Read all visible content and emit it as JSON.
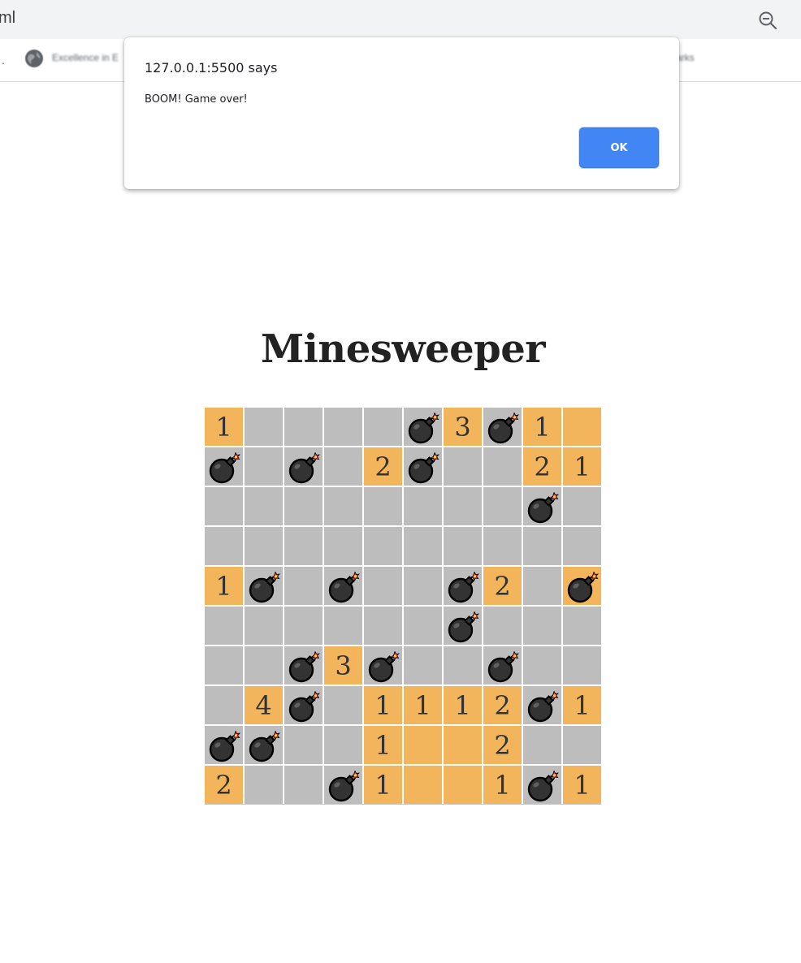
{
  "browser": {
    "url_fragment": "ml",
    "bookmark_dot": ".",
    "bookmark_text": "Excellence in E",
    "bookmark_right_text": "arks",
    "menu_glyph": "⋮"
  },
  "dialog": {
    "origin": "127.0.0.1:5500 says",
    "message": "BOOM! Game over!",
    "ok_label": "OK"
  },
  "page": {
    "title": "Minesweeper"
  },
  "colors": {
    "revealed_cell": "#f3b55c",
    "hidden_cell": "#bdbdbd",
    "ok_button": "#4285f4"
  },
  "board": {
    "rows": 10,
    "cols": 10,
    "legend": "R = revealed (number or blank), H = hidden, B = bomb shown",
    "cells": [
      [
        {
          "t": "R",
          "v": "1"
        },
        {
          "t": "H"
        },
        {
          "t": "H"
        },
        {
          "t": "H"
        },
        {
          "t": "H"
        },
        {
          "t": "B"
        },
        {
          "t": "R",
          "v": "3"
        },
        {
          "t": "B"
        },
        {
          "t": "R",
          "v": "1"
        },
        {
          "t": "R",
          "v": ""
        }
      ],
      [
        {
          "t": "B"
        },
        {
          "t": "H"
        },
        {
          "t": "B"
        },
        {
          "t": "H"
        },
        {
          "t": "R",
          "v": "2"
        },
        {
          "t": "B"
        },
        {
          "t": "H"
        },
        {
          "t": "H"
        },
        {
          "t": "R",
          "v": "2"
        },
        {
          "t": "R",
          "v": "1"
        }
      ],
      [
        {
          "t": "H"
        },
        {
          "t": "H"
        },
        {
          "t": "H"
        },
        {
          "t": "H"
        },
        {
          "t": "H"
        },
        {
          "t": "H"
        },
        {
          "t": "H"
        },
        {
          "t": "H"
        },
        {
          "t": "B"
        },
        {
          "t": "H"
        }
      ],
      [
        {
          "t": "H"
        },
        {
          "t": "H"
        },
        {
          "t": "H"
        },
        {
          "t": "H"
        },
        {
          "t": "H"
        },
        {
          "t": "H"
        },
        {
          "t": "H"
        },
        {
          "t": "H"
        },
        {
          "t": "H"
        },
        {
          "t": "H"
        }
      ],
      [
        {
          "t": "R",
          "v": "1"
        },
        {
          "t": "B"
        },
        {
          "t": "H"
        },
        {
          "t": "B"
        },
        {
          "t": "H"
        },
        {
          "t": "H"
        },
        {
          "t": "B"
        },
        {
          "t": "R",
          "v": "2"
        },
        {
          "t": "H"
        },
        {
          "t": "B",
          "rev": true
        }
      ],
      [
        {
          "t": "H"
        },
        {
          "t": "H"
        },
        {
          "t": "H"
        },
        {
          "t": "H"
        },
        {
          "t": "H"
        },
        {
          "t": "H"
        },
        {
          "t": "B"
        },
        {
          "t": "H"
        },
        {
          "t": "H"
        },
        {
          "t": "H"
        }
      ],
      [
        {
          "t": "H"
        },
        {
          "t": "H"
        },
        {
          "t": "B"
        },
        {
          "t": "R",
          "v": "3"
        },
        {
          "t": "B"
        },
        {
          "t": "H"
        },
        {
          "t": "H"
        },
        {
          "t": "B"
        },
        {
          "t": "H"
        },
        {
          "t": "H"
        }
      ],
      [
        {
          "t": "H"
        },
        {
          "t": "R",
          "v": "4"
        },
        {
          "t": "B"
        },
        {
          "t": "H"
        },
        {
          "t": "R",
          "v": "1"
        },
        {
          "t": "R",
          "v": "1"
        },
        {
          "t": "R",
          "v": "1"
        },
        {
          "t": "R",
          "v": "2"
        },
        {
          "t": "B"
        },
        {
          "t": "R",
          "v": "1"
        }
      ],
      [
        {
          "t": "B"
        },
        {
          "t": "B"
        },
        {
          "t": "H"
        },
        {
          "t": "H"
        },
        {
          "t": "R",
          "v": "1"
        },
        {
          "t": "R",
          "v": ""
        },
        {
          "t": "R",
          "v": ""
        },
        {
          "t": "R",
          "v": "2"
        },
        {
          "t": "H"
        },
        {
          "t": "H"
        }
      ],
      [
        {
          "t": "R",
          "v": "2"
        },
        {
          "t": "H"
        },
        {
          "t": "H"
        },
        {
          "t": "B"
        },
        {
          "t": "R",
          "v": "1"
        },
        {
          "t": "R",
          "v": ""
        },
        {
          "t": "R",
          "v": ""
        },
        {
          "t": "R",
          "v": "1"
        },
        {
          "t": "B"
        },
        {
          "t": "R",
          "v": "1"
        }
      ]
    ]
  }
}
